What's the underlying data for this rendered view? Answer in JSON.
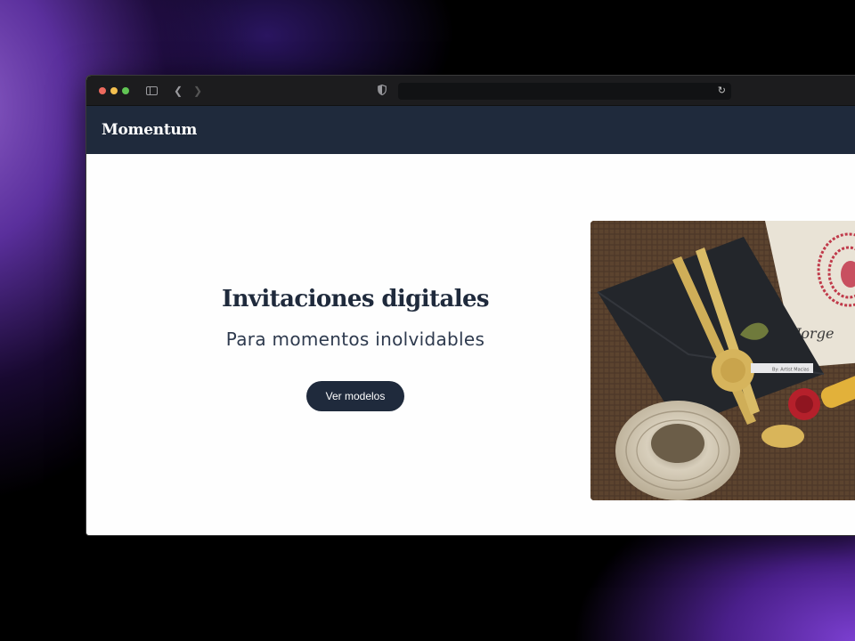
{
  "browser": {
    "traffic_lights": [
      "close",
      "minimize",
      "zoom"
    ],
    "icons": {
      "sidebar": "sidebar-toggle-icon",
      "back": "chevron-left-icon",
      "forward": "chevron-right-icon",
      "shield": "shield-icon",
      "reload": "reload-icon"
    },
    "url": ""
  },
  "site": {
    "logo": "Momentum",
    "brand_color": "#1f2a3c"
  },
  "hero": {
    "title": "Invitaciones digitales",
    "subtitle": "Para momentos inolvidables",
    "cta_label": "Ver modelos",
    "image": {
      "name": "wedding-invitation-photo",
      "card_text": "Jorge",
      "tag_text": "By: Artist Macias"
    }
  }
}
